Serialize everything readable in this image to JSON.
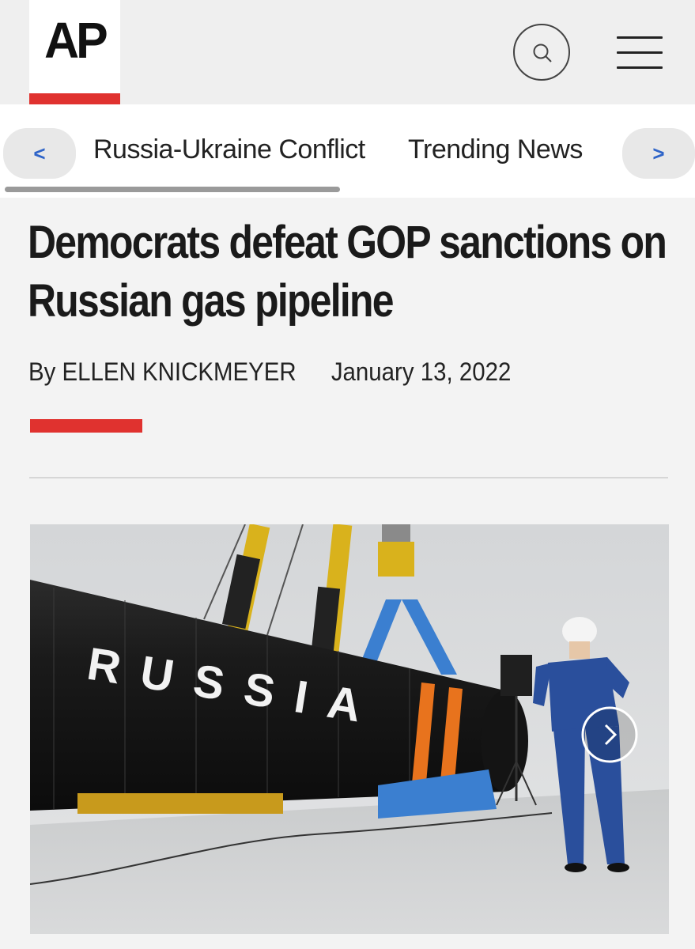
{
  "header": {
    "logo": "AP",
    "search_icon": "search-icon",
    "menu_icon": "hamburger-menu-icon",
    "accent_color": "#e0322f"
  },
  "nav": {
    "prev_label": "<",
    "next_label": ">",
    "links": [
      "Russia-Ukraine Conflict",
      "Trending News"
    ],
    "arrow_color": "#2e64c8"
  },
  "article": {
    "headline": "Democrats defeat GOP sanctions on Russian gas pipeline",
    "author": "By ELLEN KNICKMEYER",
    "date": "January 13, 2022"
  },
  "photo": {
    "pipe_text": "RUSSIA",
    "next_icon": "chevron-right-icon"
  }
}
